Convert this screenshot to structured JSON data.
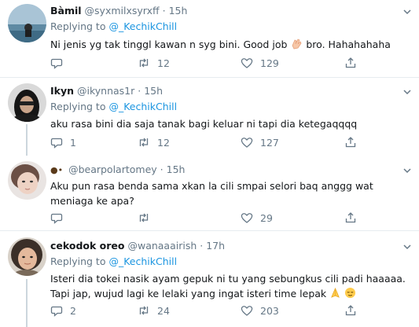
{
  "icons": {
    "reply": "reply-icon",
    "retweet": "retweet-icon",
    "like": "heart-icon",
    "share": "share-icon",
    "more": "chevron-down-icon"
  },
  "colors": {
    "link": "#1b95e0",
    "muted": "#657786",
    "divider": "#e6ecf0",
    "thread": "#ccd6dd"
  },
  "tweets": [
    {
      "name": "Bàmil",
      "handle": "@syxmilxsyrxff",
      "dot": "·",
      "time": "15h",
      "replying_prefix": "Replying to ",
      "replying_to": "@_KechikChill",
      "text_before": "Ni jenis yg tak tinggl kawan n syg bini. Good job ",
      "text_after": " bro. Hahahahaha",
      "replies": "",
      "retweets": "12",
      "likes": "129"
    },
    {
      "name": "Ikyn",
      "handle": "@ikynnas1r",
      "dot": "·",
      "time": "15h",
      "replying_prefix": "Replying to ",
      "replying_to": "@_KechikChill",
      "text": "aku rasa bini dia saja tanak bagi keluar ni tapi dia ketegaqqqq",
      "replies": "1",
      "retweets": "12",
      "likes": "127"
    },
    {
      "name": "",
      "handle": "@bearpolartomey",
      "dot": "·",
      "time": "15h",
      "text": "Aku pun rasa benda sama xkan la cili smpai selori baq anggg wat meniaga ke apa?",
      "replies": "",
      "retweets": "",
      "likes": "29"
    },
    {
      "name": "cekodok oreo",
      "handle": "@wanaaairish",
      "dot": "·",
      "time": "17h",
      "replying_prefix": "Replying to ",
      "replying_to": "@_KechikChill",
      "text": "Isteri dia tokei nasik ayam gepuk ni tu yang sebungkus cili padi haaaaa. Tapi jap, wujud lagi ke lelaki yang ingat isteri time lepak",
      "replies": "2",
      "retweets": "24",
      "likes": "203"
    }
  ]
}
